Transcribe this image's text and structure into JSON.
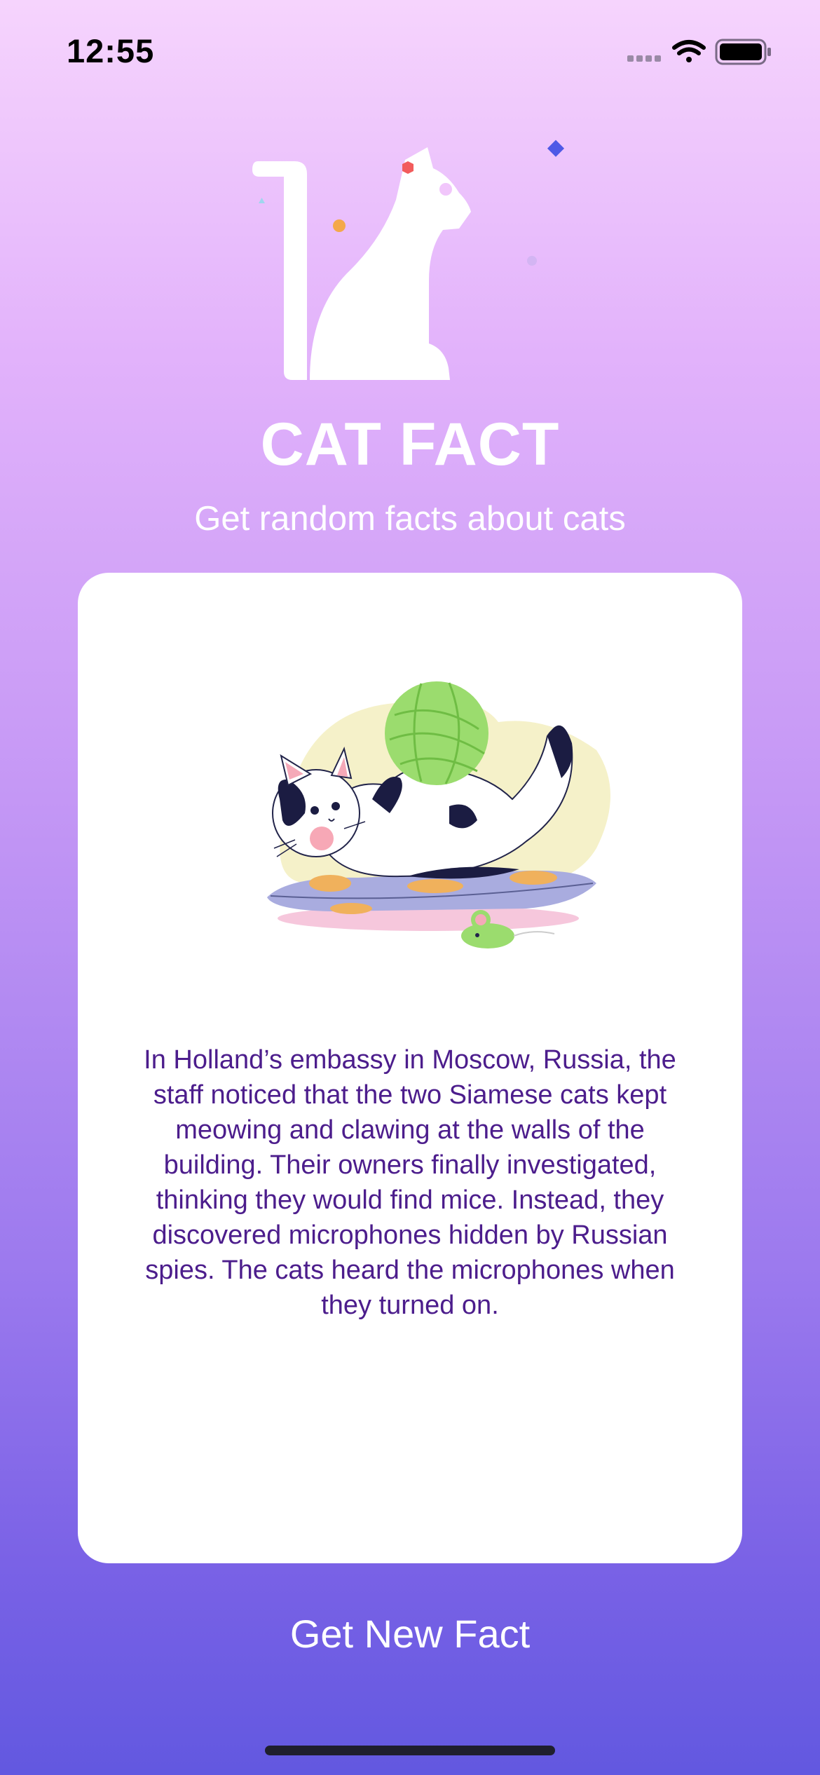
{
  "status_bar": {
    "time": "12:55",
    "icons": [
      "cellular-signal-icon",
      "wifi-icon",
      "battery-icon"
    ]
  },
  "app": {
    "logo": "cat-silhouette-logo",
    "title": "CAT FACT",
    "subtitle": "Get random facts about cats"
  },
  "card": {
    "illustration": "cat-playing-with-yarn-illustration",
    "fact": "In Holland’s embassy in Moscow, Russia, the staff noticed that the two Siamese cats kept meowing and clawing at the walls of the building. Their owners finally investigated, thinking they would find mice. Instead, they discovered microphones hidden by Russian spies. The cats heard the microphones when they turned on."
  },
  "actions": {
    "new_fact_label": "Get New Fact"
  },
  "colors": {
    "fact_text": "#4c1d8c",
    "card_background": "#ffffff",
    "gradient_top": "#f6d4fd",
    "gradient_bottom": "#6258e0"
  }
}
